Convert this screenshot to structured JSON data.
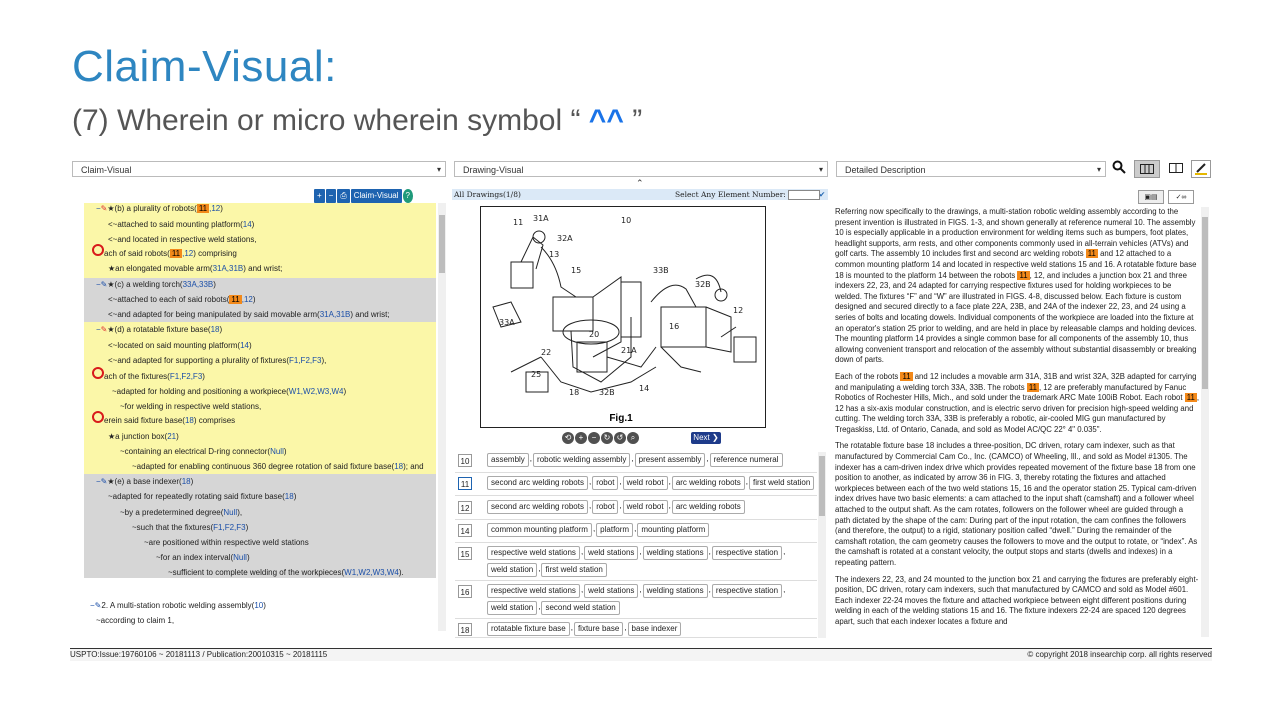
{
  "title": "Claim-Visual:",
  "subtitle_prefix": "(7) Wherein or micro wherein symbol “",
  "subtitle_symbol": " ^^ ",
  "subtitle_suffix": "”",
  "dropdowns": {
    "left": "Claim-Visual",
    "mid": "Drawing-Visual",
    "right": "Detailed Description"
  },
  "left_toolbar": {
    "claim_visual": "Claim-Visual",
    "plus": "+",
    "minus": "−",
    "help": "?"
  },
  "claims": {
    "r1_a": "(b) a plurality of robots(",
    "r1_n1": "11",
    "r1_n2": ",12",
    "r1_c": ")",
    "r2_a": "<~attached to said mounting platform(",
    "r2_n": "14",
    "r2_c": ")",
    "r3": "<~and located in respective weld stations,",
    "r4_a": "ach of said robots(",
    "r4_n1": "11",
    "r4_n2": ",12",
    "r4_c": ") comprising",
    "r5_a": "★an elongated movable arm(",
    "r5_n": "31A,31B",
    "r5_c": ") and wrist;",
    "r6_a": "(c) a welding torch(",
    "r6_n": "33A,33B",
    "r6_c": ")",
    "r7_a": "<~attached to each of said robots(",
    "r7_n1": "11",
    "r7_n2": ",12",
    "r7_c": ")",
    "r8_a": "<~and adapted for being manipulated by said movable arm(",
    "r8_n": "31A,31B",
    "r8_c": ") and wrist;",
    "r9_a": "(d) a rotatable fixture base(",
    "r9_n": "18",
    "r9_c": ")",
    "r10_a": "<~located on said mounting platform(",
    "r10_n": "14",
    "r10_c": ")",
    "r11_a": "<~and adapted for supporting a plurality of fixtures(",
    "r11_n": "F1,F2,F3",
    "r11_c": "),",
    "r12_a": "ach of the fixtures(",
    "r12_n": "F1,F2,F3",
    "r12_c": ")",
    "r13_a": "~adapted for holding and positioning a workpiece(",
    "r13_n": "W1,W2,W3,W4",
    "r13_c": ")",
    "r14": "~for welding in respective weld stations,",
    "r15_a": "erein said fixture base(",
    "r15_n": "18",
    "r15_c": ") comprises",
    "r16_a": "★a junction box(",
    "r16_n": "21",
    "r16_c": ")",
    "r17_a": "~containing an electrical D-ring connector(",
    "r17_n": "Null",
    "r17_c": ")",
    "r18_a": "~adapted for enabling continuous 360 degree rotation of said fixture base(",
    "r18_n": "18",
    "r18_c": "); and",
    "r19_a": "(e) a base indexer(",
    "r19_n": "18",
    "r19_c": ")",
    "r20_a": "~adapted for repeatedly rotating said fixture base(",
    "r20_n": "18",
    "r20_c": ")",
    "r21_a": "~by a predetermined degree(",
    "r21_n": "Null",
    "r21_c": "),",
    "r22_a": "~such that the fixtures(",
    "r22_n": "F1,F2,F3",
    "r22_c": ")",
    "r23": "~are positioned within respective weld stations",
    "r24_a": "~for an index interval(",
    "r24_n": "Null",
    "r24_c": ")",
    "r25_a": "~sufficient to complete welding of the workpieces(",
    "r25_n": "W1,W2,W3,W4",
    "r25_c": ").",
    "c2_a": "2. A multi-station robotic welding assembly(",
    "c2_n": "10",
    "c2_c": ")",
    "c2_b": "~according to claim 1,"
  },
  "drawings": {
    "header": "All Drawings(1/8)",
    "select_label": "Select Any Element Number:",
    "figure_label": "Fig.1",
    "next": "Next",
    "zoom_icons": [
      "⟲",
      "+",
      "−",
      "↻",
      "↺",
      "⌕"
    ],
    "labels": [
      "11",
      "31A",
      "10",
      "32A",
      "13",
      "15",
      "33B",
      "32B",
      "33A",
      "12",
      "16",
      "22",
      "21A",
      "25",
      "20",
      "18",
      "32B",
      "14"
    ],
    "rows": [
      {
        "num": "10",
        "tags": [
          "assembly",
          "robotic welding assembly",
          "present assembly",
          "reference numeral"
        ]
      },
      {
        "num": "11",
        "tags": [
          "second arc welding robots",
          "robot",
          "weld robot",
          "arc welding robots",
          "first weld station"
        ]
      },
      {
        "num": "12",
        "tags": [
          "second arc welding robots",
          "robot",
          "weld robot",
          "arc welding robots"
        ]
      },
      {
        "num": "14",
        "tags": [
          "common mounting platform",
          "platform",
          "mounting platform"
        ]
      },
      {
        "num": "15",
        "tags": [
          "respective weld stations",
          "weld stations",
          "welding stations",
          "respective station",
          "weld station",
          "first weld station"
        ]
      },
      {
        "num": "16",
        "tags": [
          "respective weld stations",
          "weld stations",
          "welding stations",
          "respective station",
          "weld station",
          "second weld station"
        ]
      },
      {
        "num": "18",
        "tags": [
          "rotatable fixture base",
          "fixture base",
          "base indexer"
        ]
      }
    ]
  },
  "description": {
    "p1a": "Referring now specifically to the drawings, a multi-station robotic welding assembly according to the present invention is illustrated in FIGS. 1-3, and shown generally at reference numeral 10. The assembly 10 is especially applicable in a production environment for welding items such as bumpers, foot plates, headlight supports, arm rests, and other components commonly used in all-terrain vehicles (ATVs) and golf carts. The assembly 10 includes first and second arc welding robots",
    "p1n1": "11",
    "p1b": "and 12 attached to a common mounting platform 14 and located in respective weld stations 15 and 16. A rotatable fixture base 18 is mounted to the platform 14 between the robots",
    "p1n2": "11",
    "p1c": ", 12, and includes a junction box 21 and three indexers 22, 23, and 24 adapted for carrying respective fixtures used for holding workpieces to be welded. The fixtures “F” and “W” are illustrated in FIGS. 4-8, discussed below. Each fixture is custom designed and secured directly to a face plate 22A, 23B, and 24A of the indexer 22, 23, and 24 using a series of bolts and locating dowels. Individual components of the workpiece are loaded into the fixture at an operator's station 25 prior to welding, and are held in place by releasable clamps and holding devices. The mounting platform 14 provides a single common base for all components of the assembly 10, thus allowing convenient transport and relocation of the assembly without substantial disassembly or breaking down of parts.",
    "p2a": "Each of the robots",
    "p2n1": "11",
    "p2b": "and 12 includes a movable arm 31A, 31B and wrist 32A, 32B adapted for carrying and manipulating a welding torch 33A, 33B. The robots",
    "p2n2": "11",
    "p2c": ", 12 are preferably manufactured by Fanuc Robotics of Rochester Hills, Mich., and sold under the trademark ARC Mate 100iB Robot. Each robot",
    "p2n3": "11",
    "p2d": ", 12 has a six-axis modular construction, and is electric servo driven for precision high-speed welding and cutting. The welding torch 33A, 33B is preferably a robotic, air-cooled MIG gun manufactured by Tregaskiss, Ltd. of Ontario, Canada, and sold as Model AC/QC 22° 4\" 0.035\".",
    "p3": "The rotatable fixture base 18 includes a three-position, DC driven, rotary cam indexer, such as that manufactured by Commercial Cam Co., Inc. (CAMCO) of Wheeling, Ill., and sold as Model #1305. The indexer has a cam-driven index drive which provides repeated movement of the fixture base 18 from one position to another, as indicated by arrow 36 in FIG. 3, thereby rotating the fixtures and attached workpieces between each of the two weld stations 15, 16 and the operator station 25. Typical cam-driven index drives have two basic elements: a cam attached to the input shaft (camshaft) and a follower wheel attached to the output shaft. As the cam rotates, followers on the follower wheel are guided through a path dictated by the shape of the cam: During part of the input rotation, the cam confines the followers (and therefore, the output) to a rigid, stationary position called “dwell.” During the remainder of the camshaft rotation, the cam geometry causes the followers to move and the output to rotate, or “index”. As the camshaft is rotated at a constant velocity, the output stops and starts (dwells and indexes) in a repeating pattern.",
    "p4": "The indexers 22, 23, and 24 mounted to the junction box 21 and carrying the fixtures are preferably eight-position, DC driven, rotary cam indexers, such that manufactured by CAMCO and sold as Model #601. Each indexer 22-24 moves the fixture and attached workpiece between eight different positions during welding in each of the welding stations 15 and 16. The fixture indexers 22-24 are spaced 120 degrees apart, such that each indexer locates a fixture and"
  },
  "footer": {
    "left": "USPTO:Issue:19760106 ~ 20181113 / Publication:20010315 ~ 20181115",
    "right": "© copyright 2018 insearchip corp. all rights reserved"
  },
  "colors": {
    "title": "#2e86c1",
    "highlight": "#f2891a",
    "claim_yellow": "#fbf7a8",
    "claim_gray": "#d6d6d6",
    "link_blue": "#1b4fa8"
  }
}
